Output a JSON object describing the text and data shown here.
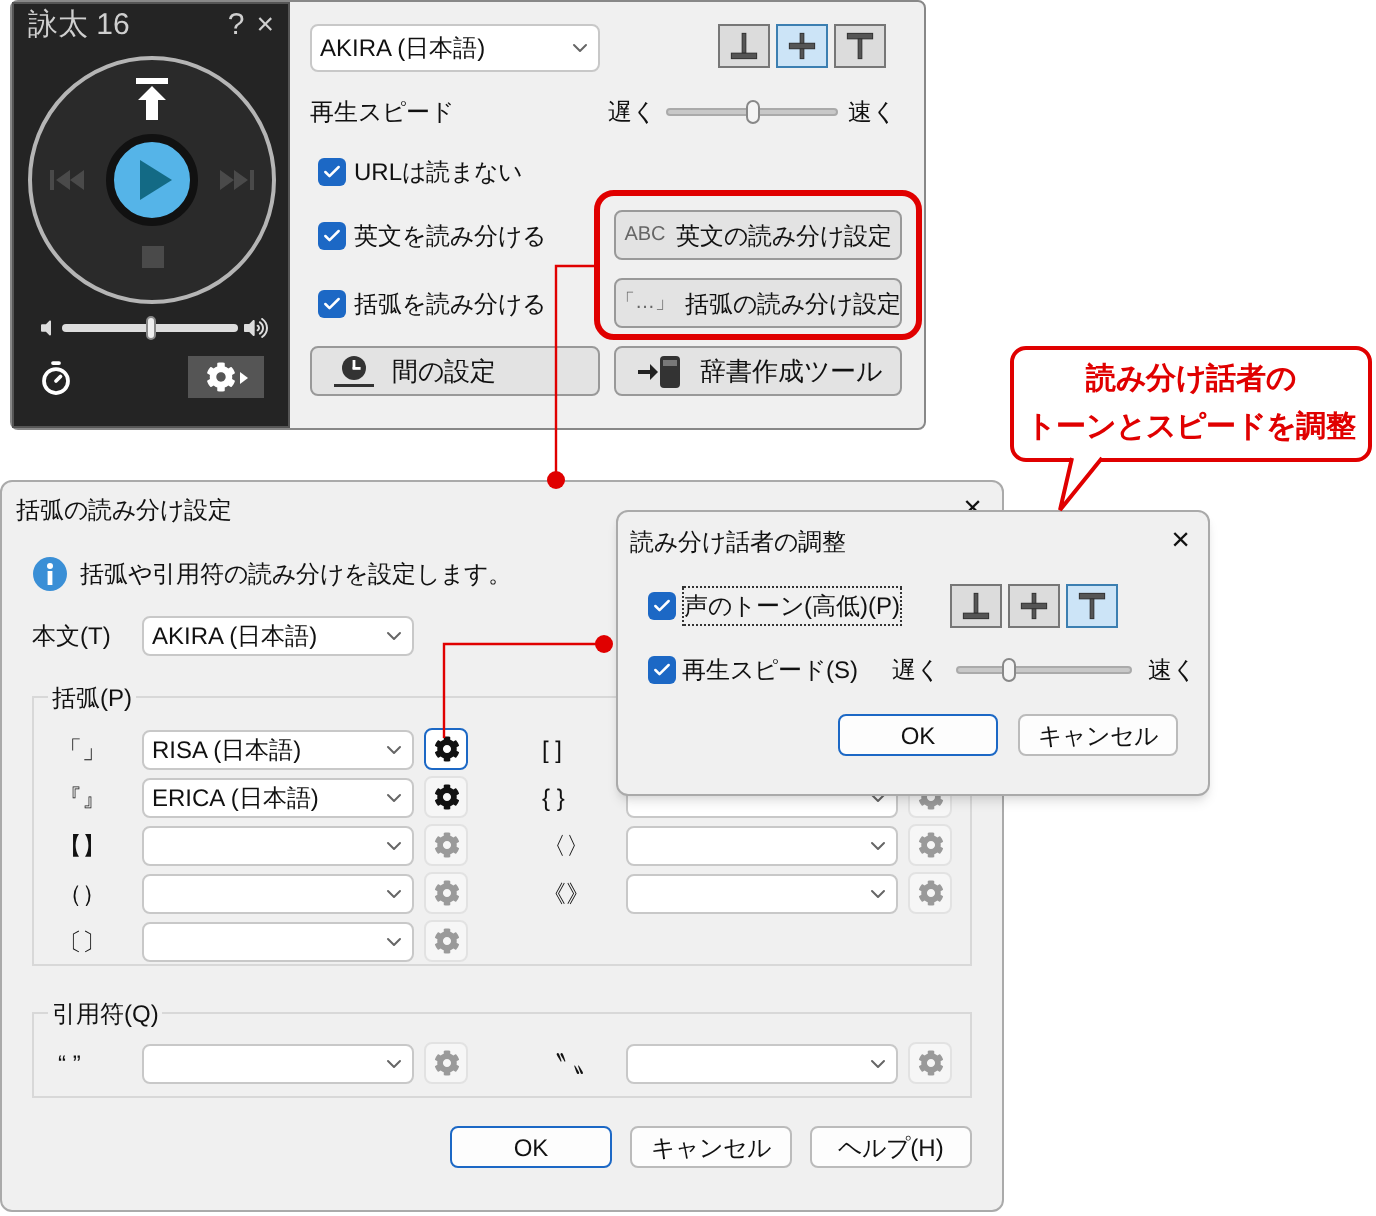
{
  "player": {
    "title": "詠太 16",
    "help": "?",
    "close": "×",
    "volume": {
      "level": 0.5
    },
    "voice": "AKIRA (日本語)",
    "tones": [
      {
        "kind": "low",
        "selected": false
      },
      {
        "kind": "mid",
        "selected": true
      },
      {
        "kind": "high",
        "selected": false
      }
    ],
    "speed": {
      "label": "再生スピード",
      "slow": "遅く",
      "fast": "速く",
      "level": 0.5
    },
    "options": [
      {
        "label": "URLは読まない",
        "checked": true
      },
      {
        "label": "英文を読み分ける",
        "checked": true
      },
      {
        "label": "括弧を読み分ける",
        "checked": true
      }
    ],
    "setting_buttons": [
      {
        "prefix": "ABC",
        "label": "英文の読み分け設定"
      },
      {
        "prefix": "「…」",
        "label": "括弧の読み分け設定"
      }
    ],
    "tool_buttons": [
      {
        "kind": "pause",
        "label": "間の設定"
      },
      {
        "kind": "dictionary",
        "label": "辞書作成ツール"
      }
    ]
  },
  "bracket_dialog": {
    "title": "括弧の読み分け設定",
    "close": "×",
    "info": "括弧や引用符の読み分けを設定します。",
    "body_label": "本文(T)",
    "body_voice": "AKIRA (日本語)",
    "brackets_legend": "括弧(P)",
    "left_brackets": [
      {
        "mark": "「」",
        "voice": "RISA (日本語)",
        "gear_enabled": true,
        "gear_focused": true
      },
      {
        "mark": "『』",
        "voice": "ERICA (日本語)",
        "gear_enabled": true,
        "gear_focused": false
      },
      {
        "mark": "【】",
        "gear_enabled": false,
        "gear_focused": false
      },
      {
        "mark": "（）",
        "gear_enabled": false,
        "gear_focused": false
      },
      {
        "mark": "〔〕",
        "gear_enabled": false,
        "gear_focused": false
      }
    ],
    "right_brackets": [
      {
        "mark": "[ ]"
      },
      {
        "mark": "{ }",
        "gear_enabled": false
      },
      {
        "mark": "〈〉",
        "gear_enabled": false
      },
      {
        "mark": "《》",
        "gear_enabled": false
      }
    ],
    "quotes_legend": "引用符(Q)",
    "quotes": [
      {
        "mark": "“ ”",
        "gear_enabled": false
      },
      {
        "mark": "〝 〟",
        "gear_enabled": false
      }
    ],
    "buttons": [
      {
        "label": "OK",
        "primary": true
      },
      {
        "label": "キャンセル",
        "primary": false
      },
      {
        "label": "ヘルプ(H)",
        "primary": false
      }
    ]
  },
  "tone_dialog": {
    "title": "読み分け話者の調整",
    "close": "×",
    "tone_label": "声のトーン(高低)(P)",
    "tone_checked": true,
    "tone_focused": true,
    "tones": [
      {
        "kind": "low",
        "selected": false
      },
      {
        "kind": "mid",
        "selected": false
      },
      {
        "kind": "high",
        "selected": true
      }
    ],
    "speed_label": "再生スピード(S)",
    "speed_checked": true,
    "slow": "遅く",
    "fast": "速く",
    "speed_slider": {
      "level": 0.3
    },
    "buttons": [
      {
        "label": "OK",
        "primary": true
      },
      {
        "label": "キャンセル",
        "primary": false
      }
    ]
  },
  "callout": {
    "lines": [
      "読み分け話者の",
      "トーンとスピードを調整"
    ]
  }
}
